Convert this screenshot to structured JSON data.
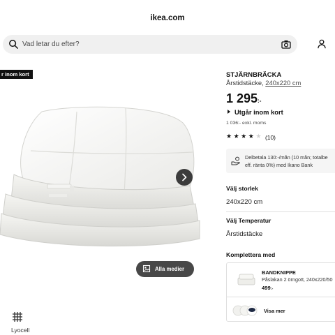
{
  "browser": {
    "url": "ikea.com"
  },
  "search": {
    "placeholder": "Vad letar du efter?"
  },
  "product": {
    "badge": "r inom kort",
    "name": "STJÄRNBRÄCKA",
    "type": "Årstidstäcke, ",
    "size_link": "240x220 cm",
    "price_main": "1 295",
    "price_suffix": ":-",
    "availability": "Utgår inom kort",
    "price_excl": "1 036:- exkl. moms",
    "rating_stars": "★★★★★",
    "rating_value": 4,
    "rating_max": 5,
    "review_count": "(10)"
  },
  "finance": {
    "line1": "Delbetala 130:-/mån (10 mån; totalbe",
    "line2": "eff. ränta 0%) med Ikano Bank"
  },
  "options": {
    "size_title": "Välj storlek",
    "size_value": "240x220 cm",
    "temp_title": "Välj Temperatur",
    "temp_value": "Årstidstäcke"
  },
  "complement": {
    "title": "Komplettera med",
    "item_name": "BANDKNIPPE",
    "item_desc": "Påslakan 2 örngott, 240x220/50",
    "item_price": "499",
    "item_price_suffix": ":-",
    "see_more": "Visa mer"
  },
  "gallery": {
    "all_media": "Alla medier"
  },
  "material": {
    "label": "Lyocell"
  },
  "colors": {
    "dark_button": "#3c3c3c",
    "badge_bg": "#111111",
    "search_bg": "#f0f0f0"
  }
}
